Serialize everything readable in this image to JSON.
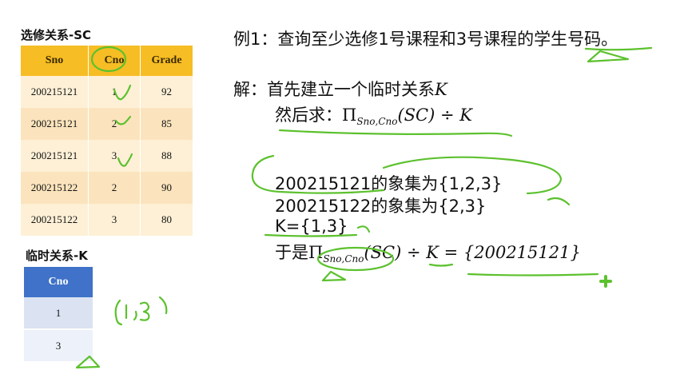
{
  "sc_table": {
    "caption": "选修关系-SC",
    "headers": [
      "Sno",
      "Cno",
      "Grade"
    ],
    "rows": [
      [
        "200215121",
        "1",
        "92"
      ],
      [
        "200215121",
        "2",
        "85"
      ],
      [
        "200215121",
        "3",
        "88"
      ],
      [
        "200215122",
        "2",
        "90"
      ],
      [
        "200215122",
        "3",
        "80"
      ]
    ]
  },
  "k_table": {
    "caption": "临时关系-K",
    "header": "Cno",
    "rows": [
      "1",
      "3"
    ]
  },
  "content": {
    "example": "例1：查询至少选修1号课程和3号课程的学生号码。",
    "solution_label": "解：",
    "step1_text": "首先建立一个临时关系",
    "step1_var": "K",
    "step2_prefix": "然后求：",
    "pi": "Π",
    "sub_sno_cno": "Sno,Cno",
    "expr_tail": "(SC) ÷ K",
    "image_set_1": "200215121的象集为{1,2,3}",
    "image_set_2": "200215122的象集为{2,3}",
    "k_set": "K={1,3}",
    "conclusion_prefix": "于是",
    "conclusion_tail": "(SC) ÷ K = {200215121}"
  },
  "handwriting": {
    "ink_color": "#5cc12e",
    "note": "{1,3}"
  }
}
